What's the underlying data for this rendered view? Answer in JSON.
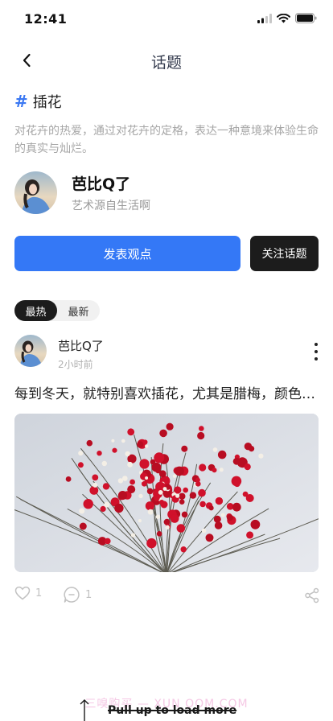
{
  "status": {
    "time": "12:41"
  },
  "nav": {
    "title": "话题"
  },
  "topic": {
    "name": "插花",
    "description": "对花卉的热爱，通过对花卉的定格，表达一种意境来体验生命的真实与灿烂。",
    "creator": {
      "name": "芭比Q了",
      "bio": "艺术源自生活啊"
    }
  },
  "buttons": {
    "publish": "发表观点",
    "follow": "关注话题"
  },
  "sort_tabs": [
    {
      "label": "最热",
      "active": true
    },
    {
      "label": "最新",
      "active": false
    }
  ],
  "post": {
    "author": "芭比Q了",
    "time": "2小时前",
    "text": "每到冬天，就特别喜欢插花，尤其是腊梅，颜色鲜艳香气扑鼻",
    "likes": "1",
    "comments": "1"
  },
  "footer": {
    "watermark": "三嗅购买 — XUN OOM.COM",
    "pull_up": "Pull up to load more"
  },
  "colors": {
    "accent": "#3478f6",
    "dark": "#1c1c1c",
    "muted": "#a6a6a6"
  }
}
